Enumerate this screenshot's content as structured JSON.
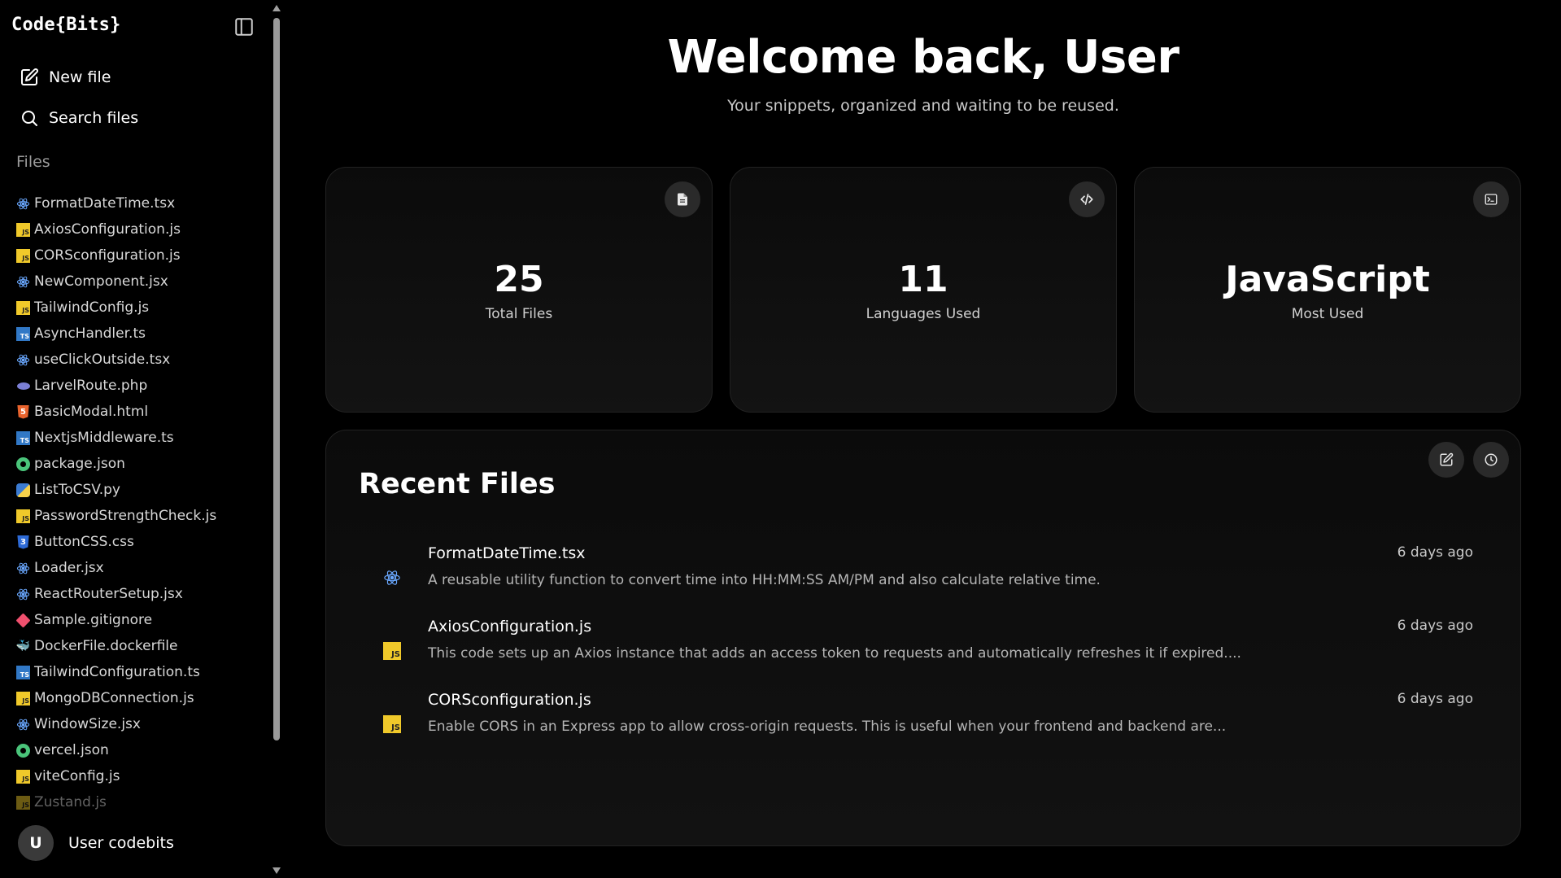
{
  "app": {
    "logo_left": "Code",
    "logo_open": "{",
    "logo_mid": "Bits",
    "logo_close": "}"
  },
  "sidebar": {
    "new_file": "New file",
    "search_files": "Search files",
    "files_heading": "Files",
    "files": [
      {
        "name": "FormatDateTime.tsx",
        "icon": "react-icon"
      },
      {
        "name": "AxiosConfiguration.js",
        "icon": "js-icon"
      },
      {
        "name": "CORSconfiguration.js",
        "icon": "js-icon"
      },
      {
        "name": "NewComponent.jsx",
        "icon": "react-icon"
      },
      {
        "name": "TailwindConfig.js",
        "icon": "js-icon"
      },
      {
        "name": "AsyncHandler.ts",
        "icon": "ts-icon"
      },
      {
        "name": "useClickOutside.tsx",
        "icon": "react-icon"
      },
      {
        "name": "LarvelRoute.php",
        "icon": "php-icon"
      },
      {
        "name": "BasicModal.html",
        "icon": "html-icon"
      },
      {
        "name": "NextjsMiddleware.ts",
        "icon": "ts-icon"
      },
      {
        "name": "package.json",
        "icon": "json-icon"
      },
      {
        "name": "ListToCSV.py",
        "icon": "python-icon"
      },
      {
        "name": "PasswordStrengthCheck.js",
        "icon": "js-icon"
      },
      {
        "name": "ButtonCSS.css",
        "icon": "css-icon"
      },
      {
        "name": "Loader.jsx",
        "icon": "react-icon"
      },
      {
        "name": "ReactRouterSetup.jsx",
        "icon": "react-icon"
      },
      {
        "name": "Sample.gitignore",
        "icon": "git-icon"
      },
      {
        "name": "DockerFile.dockerfile",
        "icon": "docker-icon"
      },
      {
        "name": "TailwindConfiguration.ts",
        "icon": "ts-icon"
      },
      {
        "name": "MongoDBConnection.js",
        "icon": "js-icon"
      },
      {
        "name": "WindowSize.jsx",
        "icon": "react-icon"
      },
      {
        "name": "vercel.json",
        "icon": "json-icon"
      },
      {
        "name": "viteConfig.js",
        "icon": "js-icon"
      },
      {
        "name": "Zustand.js",
        "icon": "js-icon"
      }
    ],
    "user_initial": "U",
    "user_name": "User codebits"
  },
  "header": {
    "title": "Welcome back, User",
    "subtitle": "Your snippets, organized and waiting to be reused."
  },
  "stats": [
    {
      "value": "25",
      "label": "Total Files",
      "icon": "file-icon"
    },
    {
      "value": "11",
      "label": "Languages Used",
      "icon": "code-icon"
    },
    {
      "value": "JavaScript",
      "label": "Most Used",
      "icon": "terminal-icon"
    }
  ],
  "recent": {
    "title": "Recent Files",
    "items": [
      {
        "name": "FormatDateTime.tsx",
        "desc": "A reusable utility function to convert time into HH:MM:SS AM/PM and also calculate relative time.",
        "time": "6 days ago",
        "icon": "react-icon"
      },
      {
        "name": "AxiosConfiguration.js",
        "desc": "This code sets up an Axios instance that adds an access token to requests and automatically refreshes it if expired....",
        "time": "6 days ago",
        "icon": "js-icon"
      },
      {
        "name": "CORSconfiguration.js",
        "desc": "Enable CORS in an Express app to allow cross-origin requests. This is useful when your frontend and backend are...",
        "time": "6 days ago",
        "icon": "js-icon"
      }
    ]
  },
  "colors": {
    "background": "#000000",
    "card": "#101010",
    "js": "#f0c92a",
    "ts": "#3178c6",
    "react": "#6aa8ff"
  }
}
